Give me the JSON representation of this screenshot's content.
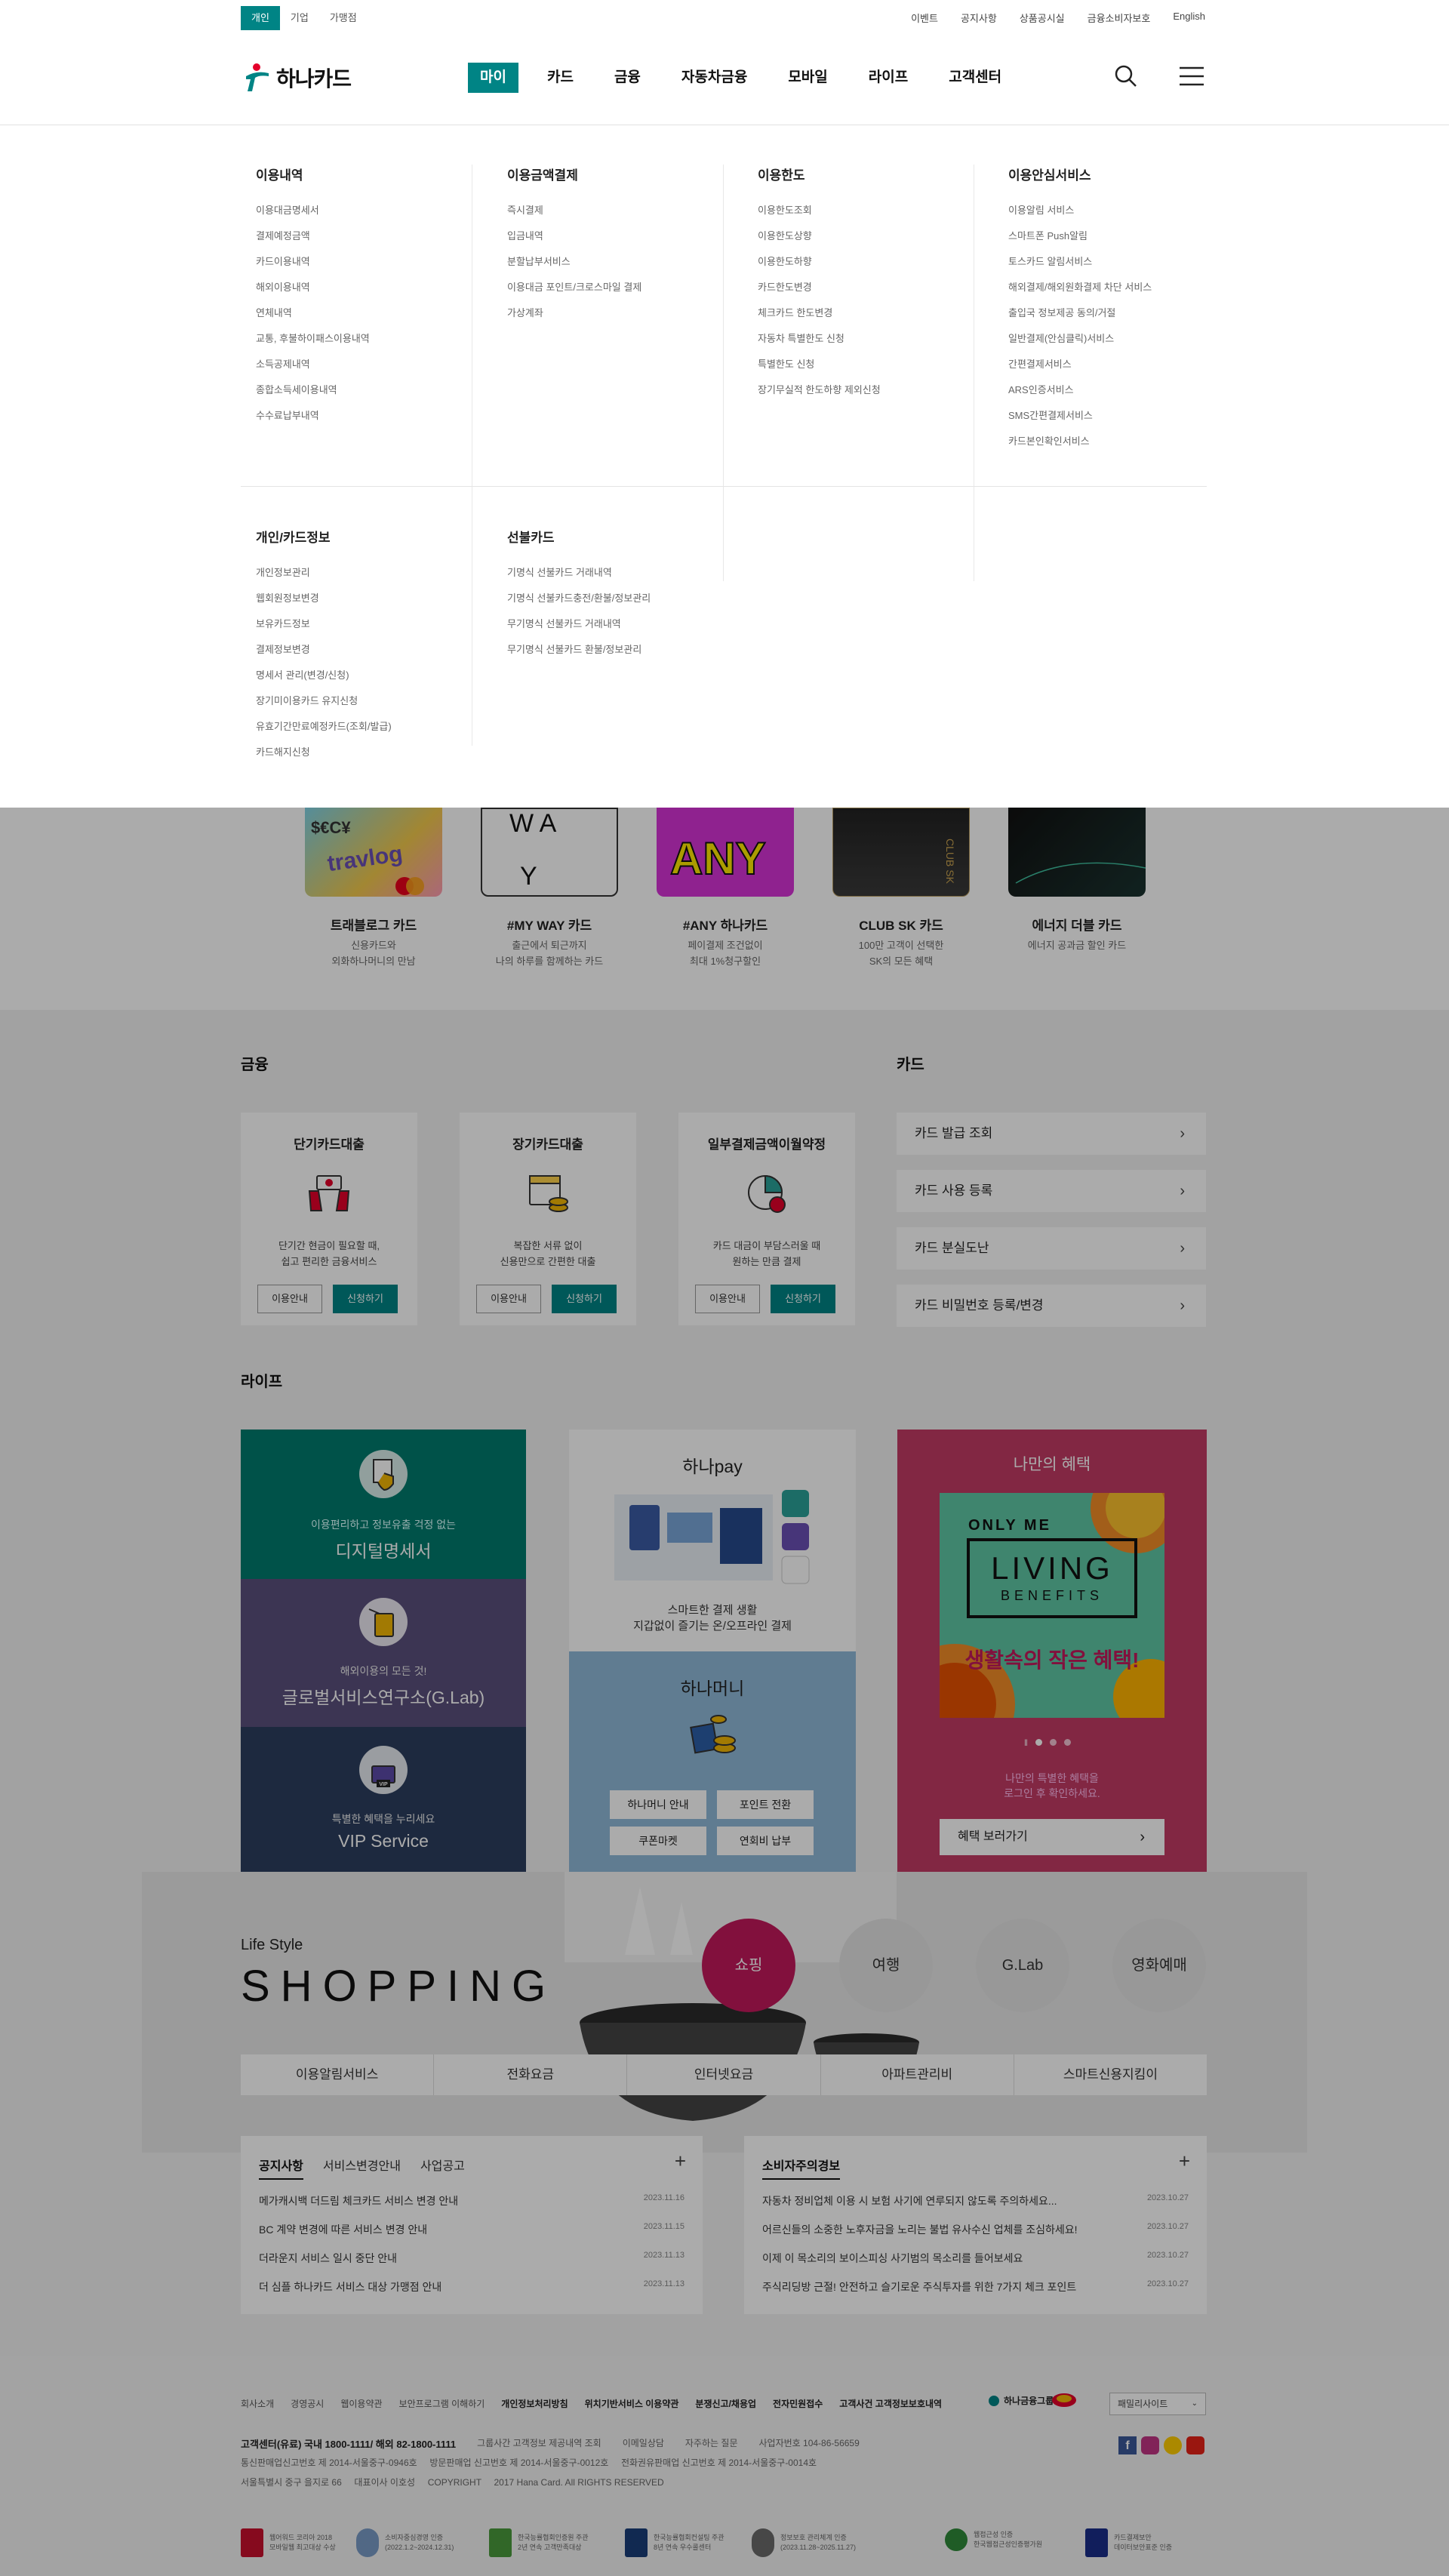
{
  "util": {
    "segments": [
      "개인",
      "기업",
      "가맹점"
    ],
    "links": [
      "이벤트",
      "공지사항",
      "상품공시실",
      "금융소비자보호",
      "English"
    ]
  },
  "header": {
    "brand": "하나카드",
    "menu": [
      "마이",
      "카드",
      "금융",
      "자동차금융",
      "모바일",
      "라이프",
      "고객센터"
    ]
  },
  "mega": {
    "col1": {
      "title": "이용내역",
      "items": [
        "이용대금명세서",
        "결제예정금액",
        "카드이용내역",
        "해외이용내역",
        "연체내역",
        "교통, 후불하이패스이용내역",
        "소득공제내역",
        "종합소득세이용내역",
        "수수료납부내역"
      ]
    },
    "col2": {
      "title": "이용금액결제",
      "items": [
        "즉시결제",
        "입금내역",
        "분할납부서비스",
        "이용대금 포인트/크로스마일 결제",
        "가상계좌"
      ]
    },
    "col3": {
      "title": "이용한도",
      "items": [
        "이용한도조회",
        "이용한도상향",
        "이용한도하향",
        "카드한도변경",
        "체크카드 한도변경",
        "자동차 특별한도 신청",
        "특별한도 신청",
        "장기무실적 한도하향 제외신청"
      ]
    },
    "col4": {
      "title": "이용안심서비스",
      "items": [
        "이용알림 서비스",
        "스마트폰 Push알림",
        "토스카드 알림서비스",
        "해외결제/해외원화결제 차단 서비스",
        "출입국 정보제공 동의/거절",
        "일반결제(안심클릭)서비스",
        "간편결제서비스",
        "ARS인증서비스",
        "SMS간편결제서비스",
        "카드본인확인서비스"
      ]
    },
    "col5": {
      "title": "개인/카드정보",
      "items": [
        "개인정보관리",
        "웹회원정보변경",
        "보유카드정보",
        "결제정보변경",
        "명세서 관리(변경/신청)",
        "장기미이용카드 유지신청",
        "유효기간만료예정카드(조회/발급)",
        "카드해지신청"
      ]
    },
    "col6": {
      "title": "선불카드",
      "items": [
        "기명식 선불카드 거래내역",
        "기명식 선불카드충전/환불/정보관리",
        "무기명식 선불카드 거래내역",
        "무기명식 선불카드 환불/정보관리"
      ]
    }
  },
  "cards": [
    {
      "name": "트래블로그 카드",
      "desc1": "신용카드와",
      "desc2": "외화하나머니의 만남"
    },
    {
      "name": "#MY WAY 카드",
      "desc1": "출근에서 퇴근까지",
      "desc2": "나의 하루를 함께하는 카드"
    },
    {
      "name": "#ANY 하나카드",
      "desc1": "페이결제 조건없이",
      "desc2": "최대 1%청구할인"
    },
    {
      "name": "CLUB SK 카드",
      "desc1": "100만 고객이 선택한",
      "desc2": "SK의 모든 혜택"
    },
    {
      "name": "에너지 더블 카드",
      "desc1": "에너지 공과금 할인 카드",
      "desc2": ""
    }
  ],
  "finance": {
    "title": "금융",
    "items": [
      {
        "title": "단기카드대출",
        "d1": "단기간 현금이 필요할 때,",
        "d2": "쉽고 편리한 금융서비스",
        "b1": "이용안내",
        "b2": "신청하기"
      },
      {
        "title": "장기카드대출",
        "d1": "복잡한 서류 없이",
        "d2": "신용만으로 간편한 대출",
        "b1": "이용안내",
        "b2": "신청하기"
      },
      {
        "title": "일부결제금액이월약정",
        "d1": "카드 대금이 부담스러울 때",
        "d2": "원하는 만큼 결제",
        "b1": "이용안내",
        "b2": "신청하기"
      }
    ]
  },
  "cardsec": {
    "title": "카드",
    "links": [
      "카드 발급 조회",
      "카드 사용 등록",
      "카드 분실도난",
      "카드 비밀번호 등록/변경"
    ]
  },
  "life": {
    "title": "라이프",
    "p1": {
      "sub": "이용편리하고 정보유출 걱정 없는",
      "main": "디지털명세서"
    },
    "p2": {
      "sub": "해외이용의 모든 것!",
      "main": "글로벌서비스연구소(G.Lab)"
    },
    "p3": {
      "sub": "특별한 혜택을 누리세요",
      "main": "VIP Service",
      "badge": "VIP"
    },
    "pay": {
      "title": "하나pay",
      "d1": "스마트한 결제 생활",
      "d2": "지갑없이 즐기는 온/오프라인 결제"
    },
    "money": {
      "title": "하나머니",
      "btns": [
        "하나머니 안내",
        "포인트 전환",
        "쿠폰마켓",
        "연회비 납부"
      ]
    },
    "benefit": {
      "title": "나만의 혜택",
      "only": "ONLY ME",
      "living": "LIVING",
      "benefits": "BENEFITS",
      "slogan": "생활속의 작은 혜택!",
      "d1": "나만의 특별한 혜택을",
      "d2": "로그인 후 확인하세요.",
      "btn": "혜택 보러가기"
    }
  },
  "shopping": {
    "small": "Life Style",
    "big": "SHOPPING",
    "circles": [
      "쇼핑",
      "여행",
      "G.Lab",
      "영화예매"
    ],
    "cats": [
      "이용알림서비스",
      "전화요금",
      "인터넷요금",
      "아파트관리비",
      "스마트신용지킴이"
    ]
  },
  "notice": {
    "tabs": [
      "공지사항",
      "서비스변경안내",
      "사업공고"
    ],
    "items": [
      {
        "t": "메가캐시백 더드림 체크카드 서비스 변경 안내",
        "d": "2023.11.16"
      },
      {
        "t": "BC 계약 변경에 따른 서비스 변경 안내",
        "d": "2023.11.15"
      },
      {
        "t": "더라운지 서비스 일시 중단 안내",
        "d": "2023.11.13"
      },
      {
        "t": "더 심플 하나카드 서비스 대상 가맹점 안내",
        "d": "2023.11.13"
      }
    ]
  },
  "consumer": {
    "title": "소비자주의경보",
    "items": [
      {
        "t": "자동차 정비업체 이용 시 보험 사기에 연루되지 않도록 주의하세요...",
        "d": "2023.10.27"
      },
      {
        "t": "어르신들의 소중한 노후자금을 노리는 불법 유사수신 업체를 조심하세요!",
        "d": "2023.10.27"
      },
      {
        "t": "이제 이 목소리의 보이스피싱 사기범의 목소리를 들어보세요",
        "d": "2023.10.27"
      },
      {
        "t": "주식리딩방 근절! 안전하고 슬기로운 주식투자를 위한 7가지 체크 포인트",
        "d": "2023.10.27"
      }
    ]
  },
  "footer": {
    "links": [
      "회사소개",
      "경영공시",
      "웹이용약관",
      "보안프로그램 이해하기",
      "개인정보처리방침",
      "위치기반서비스 이용약관",
      "분쟁신고/채용업",
      "전자민원접수",
      "고객사건 고객정보보호내역"
    ],
    "bold_from": 4,
    "group": "하나금융그룹",
    "family": "패밀리사이트",
    "line1_bold": "고객센터(유료) 국내 1800-1111/ 해외 82-1800-1111",
    "line1_rest": [
      "그룹사간 고객정보 제공내역 조회",
      "이메일상담",
      "자주하는 질문",
      "사업자번호 104-86-56659"
    ],
    "line2": "통신판매업신고번호 제 2014-서울중구-0946호     방문판매업 신고번호 제 2014-서울중구-0012호     전화권유판매업 신고번호 제 2014-서울중구-0014호",
    "line3": "서울특별시 중구 을지로 66     대표이사 이호성     COPYRIGHT     2017 Hana Card. All RIGHTS RESERVED",
    "certs": [
      {
        "a": "웹어워드 코리아 2018",
        "b": "모바일웹 최고대상 수상",
        "c": "#c8102e"
      },
      {
        "a": "소비자중심경영 인증",
        "b": "(2022.1.2~2024.12.31)",
        "c": "#7a9cc6"
      },
      {
        "a": "한국능률협회인증원 주관",
        "b": "2년 연속 고객만족대상",
        "c": "#4a9a3c"
      },
      {
        "a": "한국능률협회컨설팅 주관",
        "b": "8년 연속 우수콜센터",
        "c": "#1a3e7a"
      },
      {
        "a": "정보보호 관리체계 인증",
        "b": "(2023.11.28~2025.11.27)",
        "c": "#6a6a6a"
      },
      {
        "a": "웹접근성 인증",
        "b": "한국웹접근성인증평가원",
        "c": "#2f8a3a"
      },
      {
        "a": "카드결제보안",
        "b": "데이터보안표준 인증",
        "c": "#1a2d8a"
      }
    ]
  }
}
